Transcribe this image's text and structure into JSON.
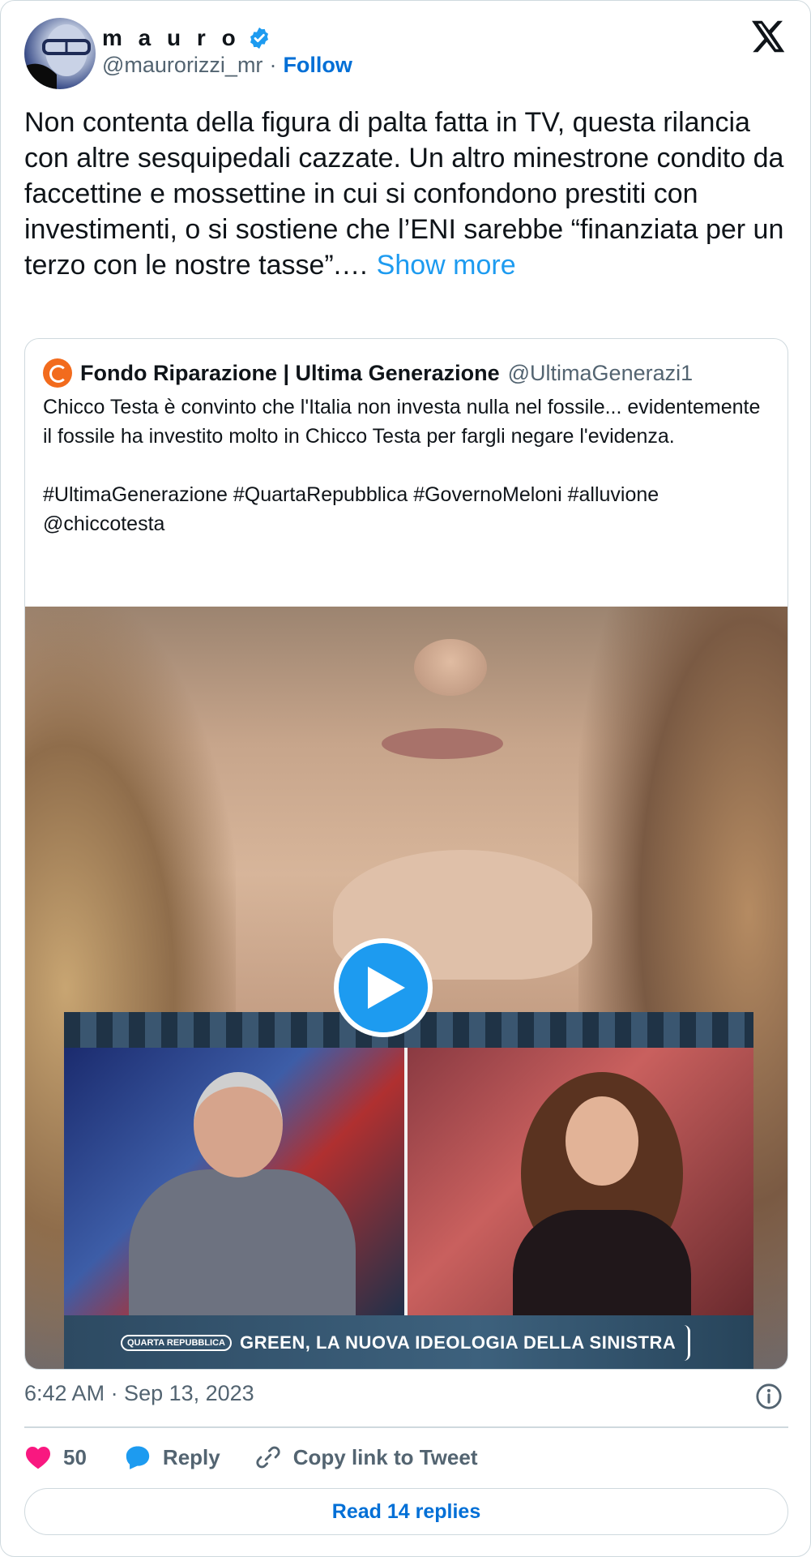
{
  "author": {
    "name": "m a u r o",
    "handle": "@maurorizzi_mr",
    "separator": "·",
    "follow_label": "Follow",
    "verified": true
  },
  "brand_icon": "x-logo-icon",
  "tweet": {
    "text": "Non contenta della figura di palta fatta in TV, questa rilancia con altre sesquipedali cazzate. Un altro minestrone condito da faccettine e mossettine in cui si confondono prestiti con investimenti, o si sostiene che l’ENI sarebbe “finanziata per un terzo con le nostre tasse”.… ",
    "show_more_label": "Show more"
  },
  "quoted_tweet": {
    "name": "Fondo Riparazione | Ultima Generazione",
    "handle": "@UltimaGenerazi1",
    "text": "Chicco Testa è convinto che l'Italia non investa nulla nel fossile... evidentemente il fossile ha investito molto in Chicco Testa per fargli negare l'evidenza.\n\n#UltimaGenerazione #QuartaRepubblica #GovernoMeloni #alluvione @chiccotesta",
    "video": {
      "chyron_badge": "QUARTA REPUBBLICA",
      "chyron_text": "GREEN, LA NUOVA IDEOLOGIA DELLA SINISTRA"
    }
  },
  "footer": {
    "timestamp": "6:42 AM · Sep 13, 2023",
    "like_count": "50",
    "reply_label": "Reply",
    "copy_link_label": "Copy link to Tweet",
    "read_replies_label": "Read 14 replies"
  },
  "colors": {
    "accent": "#1d9bf0",
    "link": "#006fd6",
    "like": "#f91880",
    "muted": "#536471",
    "border": "#cfd9de"
  }
}
